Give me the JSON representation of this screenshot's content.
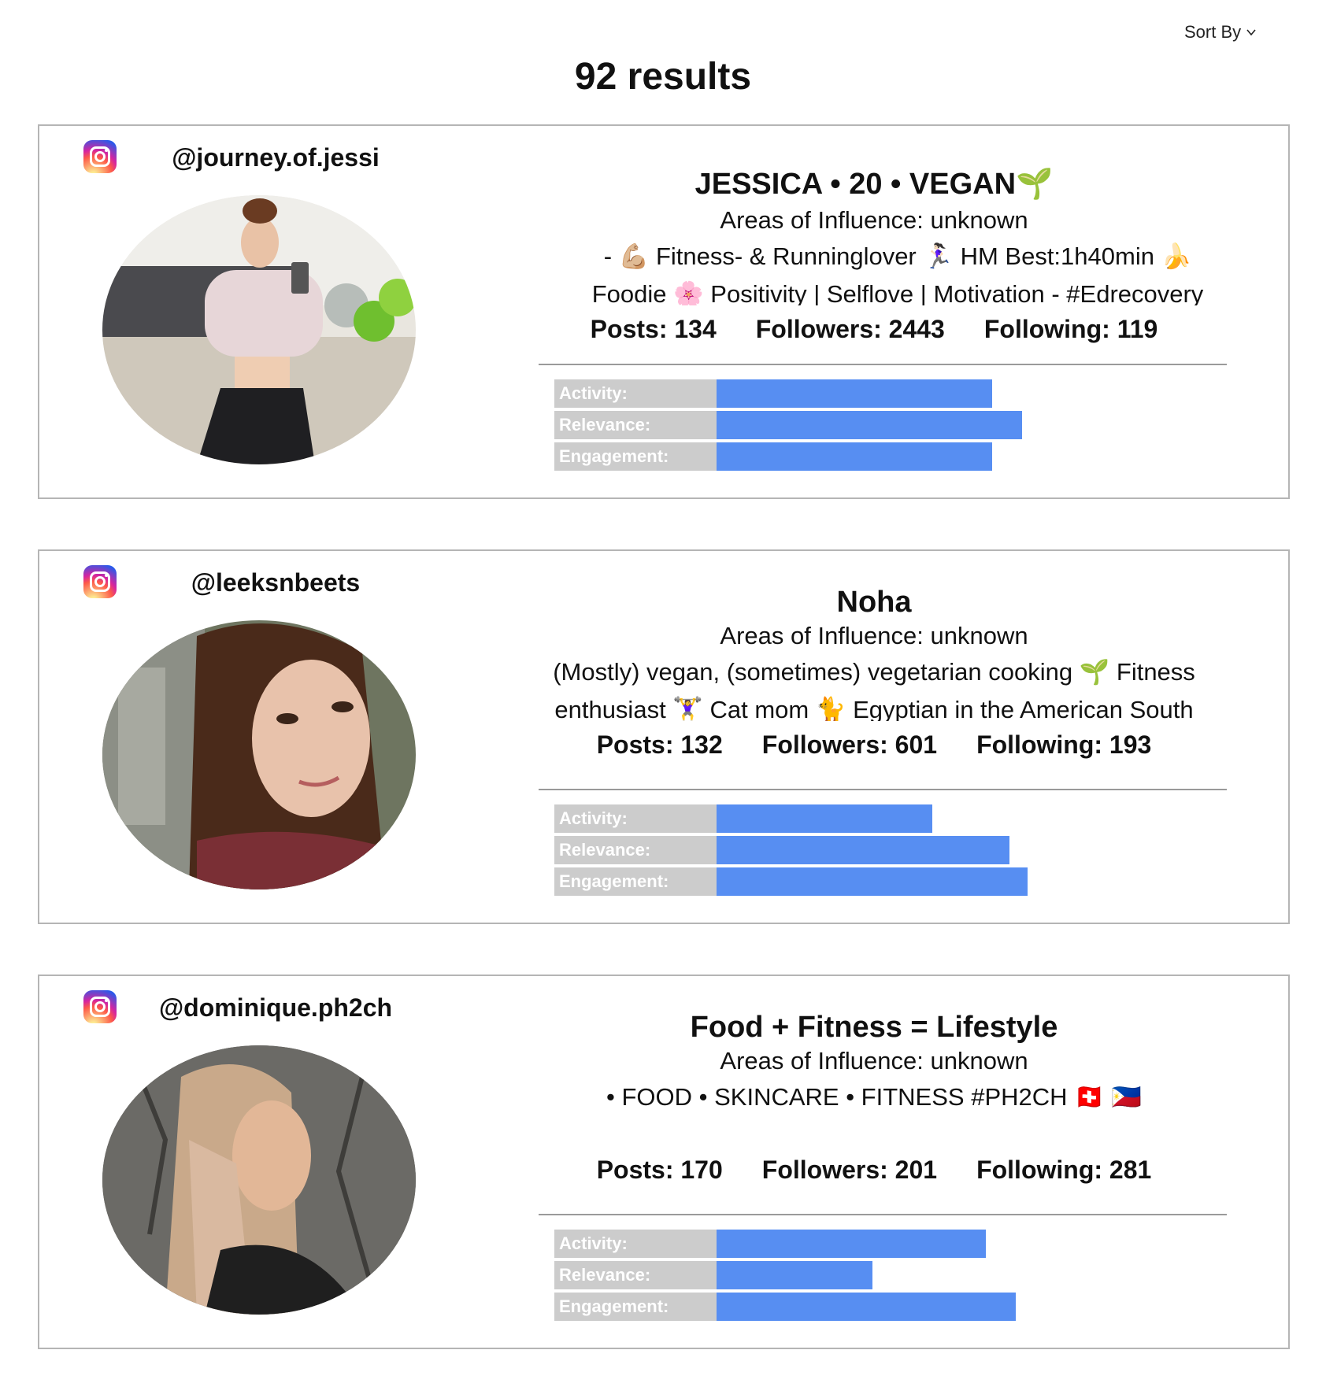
{
  "header": {
    "sort_label": "Sort By",
    "results_title": "92 results"
  },
  "colors": {
    "bar": "#578ef2",
    "label_bg": "#cccccc",
    "border": "#b5b5b5"
  },
  "metric_labels": [
    "Activity:",
    "Relevance:",
    "Engagement:"
  ],
  "cards": [
    {
      "handle": "@journey.of.jessi",
      "name": "JESSICA • 20 • VEGAN🌱",
      "areas": "Areas of Influence: unknown",
      "bio_lines": [
        "- 💪🏼 Fitness- & Runninglover 🏃🏻‍♀️ HM Best:1h40min 🍌",
        "Foodie 🌸 Positivity | Selflove | Motivation - #Edrecovery"
      ],
      "stats": {
        "posts": "Posts: 134",
        "followers": "Followers: 2443",
        "following": "Following: 119"
      },
      "metrics": {
        "activity": 0.46,
        "relevance": 0.51,
        "engagement": 0.46
      }
    },
    {
      "handle": "@leeksnbeets",
      "name": "Noha",
      "areas": "Areas of Influence: unknown",
      "bio_lines": [
        "(Mostly) vegan, (sometimes) vegetarian cooking 🌱 Fitness",
        "enthusiast 🏋️‍♀️ Cat mom 🐈 Egyptian in the American South"
      ],
      "stats": {
        "posts": "Posts: 132",
        "followers": "Followers: 601",
        "following": "Following: 193"
      },
      "metrics": {
        "activity": 0.36,
        "relevance": 0.49,
        "engagement": 0.52
      }
    },
    {
      "handle": "@dominique.ph2ch",
      "name": "Food + Fitness = Lifestyle",
      "areas": "Areas of Influence: unknown",
      "bio_lines": [
        "• FOOD • SKINCARE • FITNESS #PH2CH 🇨🇭 🇵🇭",
        ""
      ],
      "stats": {
        "posts": "Posts: 170",
        "followers": "Followers: 201",
        "following": "Following: 281"
      },
      "metrics": {
        "activity": 0.45,
        "relevance": 0.26,
        "engagement": 0.5
      }
    }
  ]
}
